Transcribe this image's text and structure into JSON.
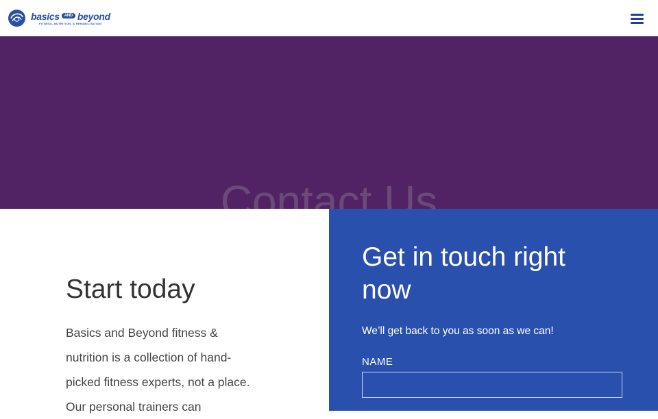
{
  "brand": {
    "name_part1": "basics",
    "name_and": "AND",
    "name_part2": "beyond",
    "tagline": "FITNESS, NUTRITION, & REHABILITATION",
    "color": "#2a4fa7"
  },
  "header": {
    "menu_icon": "hamburger-menu-icon"
  },
  "hero": {
    "title": "Contact Us",
    "background_color": "#522364"
  },
  "intro": {
    "heading": "Start today",
    "body": "Basics and Beyond fitness & nutrition is a collection of hand-picked fitness experts, not a place. Our personal trainers can"
  },
  "contact_form": {
    "heading": "Get in touch right now",
    "subheading": "We’ll get back to you as soon as we can!",
    "name_label": "NAME",
    "name_value": "",
    "background_color": "#2a50ad"
  }
}
